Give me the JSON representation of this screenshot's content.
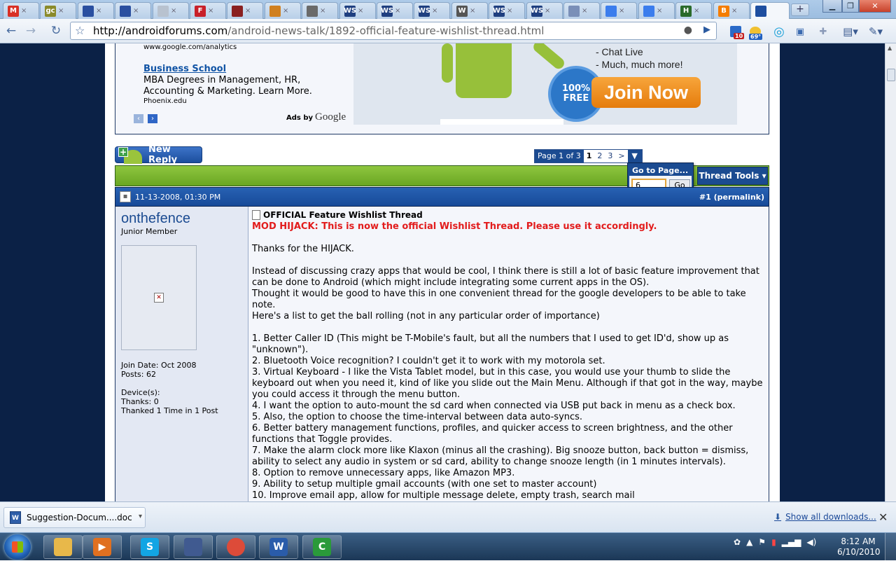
{
  "browser": {
    "tabs": [
      {
        "icon": "gmail-icon",
        "label": "M",
        "color": "#d93025"
      },
      {
        "icon": "generic-site-icon",
        "label": "gc",
        "color": "#8a8a2a"
      },
      {
        "icon": "site-icon",
        "label": "",
        "color": "#2a4fa0"
      },
      {
        "icon": "site-icon",
        "label": "",
        "color": "#2a4fa0"
      },
      {
        "icon": "page-icon",
        "label": "",
        "color": "#b8c2cf"
      },
      {
        "icon": "flipboard-icon",
        "label": "F",
        "color": "#c8202a"
      },
      {
        "icon": "crest-icon",
        "label": "",
        "color": "#8a2020"
      },
      {
        "icon": "chart-icon",
        "label": "",
        "color": "#d08020"
      },
      {
        "icon": "bird-icon",
        "label": "",
        "color": "#6a6a6a"
      },
      {
        "icon": "ws-icon",
        "label": "WS",
        "color": "#1f3f80"
      },
      {
        "icon": "ws-icon",
        "label": "WS",
        "color": "#1f3f80"
      },
      {
        "icon": "ws-icon",
        "label": "WS",
        "color": "#1f3f80"
      },
      {
        "icon": "wikipedia-icon",
        "label": "W",
        "color": "#555555"
      },
      {
        "icon": "ws-icon",
        "label": "WS",
        "color": "#1f3f80"
      },
      {
        "icon": "ws-icon",
        "label": "WS",
        "color": "#1f3f80"
      },
      {
        "icon": "document-icon",
        "label": "",
        "color": "#7a8fb8"
      },
      {
        "icon": "google-icon",
        "label": "",
        "color": "#3b7ded"
      },
      {
        "icon": "google-icon",
        "label": "",
        "color": "#3b7ded"
      },
      {
        "icon": "h-icon",
        "label": "H",
        "color": "#2a6a2a"
      },
      {
        "icon": "blogger-icon",
        "label": "B",
        "color": "#f57d00"
      },
      {
        "icon": "forum-icon",
        "label": "",
        "color": "#1f4fa0",
        "active": true
      }
    ],
    "new_tab": "+",
    "url_domain": "http://androidforums.com",
    "url_path": "/android-news-talk/1892-official-feature-wishlist-thread.html",
    "ext_badge_count": "10",
    "ext_weather": "69°"
  },
  "ads": {
    "line1_url": "www.google.com/analytics",
    "ad2_title": "Business School",
    "ad2_text": "MBA Degrees in Management, HR,\nAccounting & Marketing. Learn More.",
    "ad2_url": "Phoenix.edu",
    "ads_by": "Ads by",
    "google": "Google",
    "banner_lines": [
      "- Chat Live",
      "- Much, much more!"
    ],
    "banner_badge": "100%\nFREE",
    "banner_cta": "Join Now"
  },
  "thread": {
    "new_reply": "New Reply",
    "pager": {
      "label": "Page 1 of 3",
      "pages": [
        "1",
        "2",
        "3"
      ],
      "next": ">"
    },
    "thread_tools": "Thread Tools",
    "goto": {
      "title": "Go to Page...",
      "value": "6",
      "button": "Go"
    }
  },
  "post": {
    "date": "11-13-2008, 01:30 PM",
    "permalink": "#1 (permalink)",
    "user": {
      "name": "onthefence",
      "title": "Junior Member",
      "join_date": "Join Date: Oct 2008",
      "posts": "Posts: 62",
      "devices": "Device(s):",
      "thanks": "Thanks: 0",
      "thanked": "Thanked 1 Time in 1 Post"
    },
    "title": "OFFICIAL Feature Wishlist Thread",
    "mod_note": "MOD HIJACK: This is now the official Wishlist Thread. Please use it accordingly.",
    "body": "Thanks for the HIJACK.\n\nInstead of discussing crazy apps that would be cool, I think there is still a lot of basic feature improvement that can be done to Android (which might include integrating some current apps in the OS).\nThought it would be good to have this in one convenient thread for the google developers to be able to take note.\nHere's a list to get the ball rolling (not in any particular order of importance)\n\n1. Better Caller ID (This might be T-Mobile's fault, but all the numbers that I used to get ID'd, show up as \"unknown\").\n2. Bluetooth Voice recognition? I couldn't get it to work with my motorola set.\n3. Virtual Keyboard - I like the Vista Tablet model, but in this case, you would use your thumb to slide the keyboard out when you need it, kind of like you slide out the Main Menu. Although if that got in the way, maybe you could access it through the menu button.\n4. I want the option to auto-mount the sd card when connected via USB put back in menu as a check box.\n5. Also, the option to choose the time-interval between data auto-syncs.\n6. Better battery management functions, profiles, and quicker access to screen brightness, and the other functions that Toggle provides.\n7. Make the alarm clock more like Klaxon (minus all the crashing). Big snooze button, back button = dismiss, ability to select any audio in system or sd card, ability to change snooze length (in 1 minutes intervals).\n8. Option to remove unnecessary apps, like Amazon MP3.\n9. Ability to setup multiple gmail accounts (with one set to master account)\n10. Improve email app, allow for multiple message delete, empty trash, search mail"
  },
  "downloads": {
    "file": "Suggestion-Docum....doc",
    "show_all": "Show all downloads...",
    "close": "✕"
  },
  "taskbar": {
    "apps": [
      {
        "name": "explorer",
        "label": "",
        "color": "#e8b84a"
      },
      {
        "name": "media",
        "label": "▶",
        "color": "#e07020"
      },
      {
        "name": "skype",
        "label": "S",
        "color": "#12a5e4"
      },
      {
        "name": "gaming",
        "label": "",
        "color": "#405a90"
      },
      {
        "name": "chrome",
        "label": "",
        "color": "#dd4b39"
      },
      {
        "name": "word",
        "label": "W",
        "color": "#2a5caa"
      },
      {
        "name": "camtasia",
        "label": "C",
        "color": "#2a9a3a"
      }
    ],
    "time": "8:12 AM",
    "date": "6/10/2010"
  }
}
